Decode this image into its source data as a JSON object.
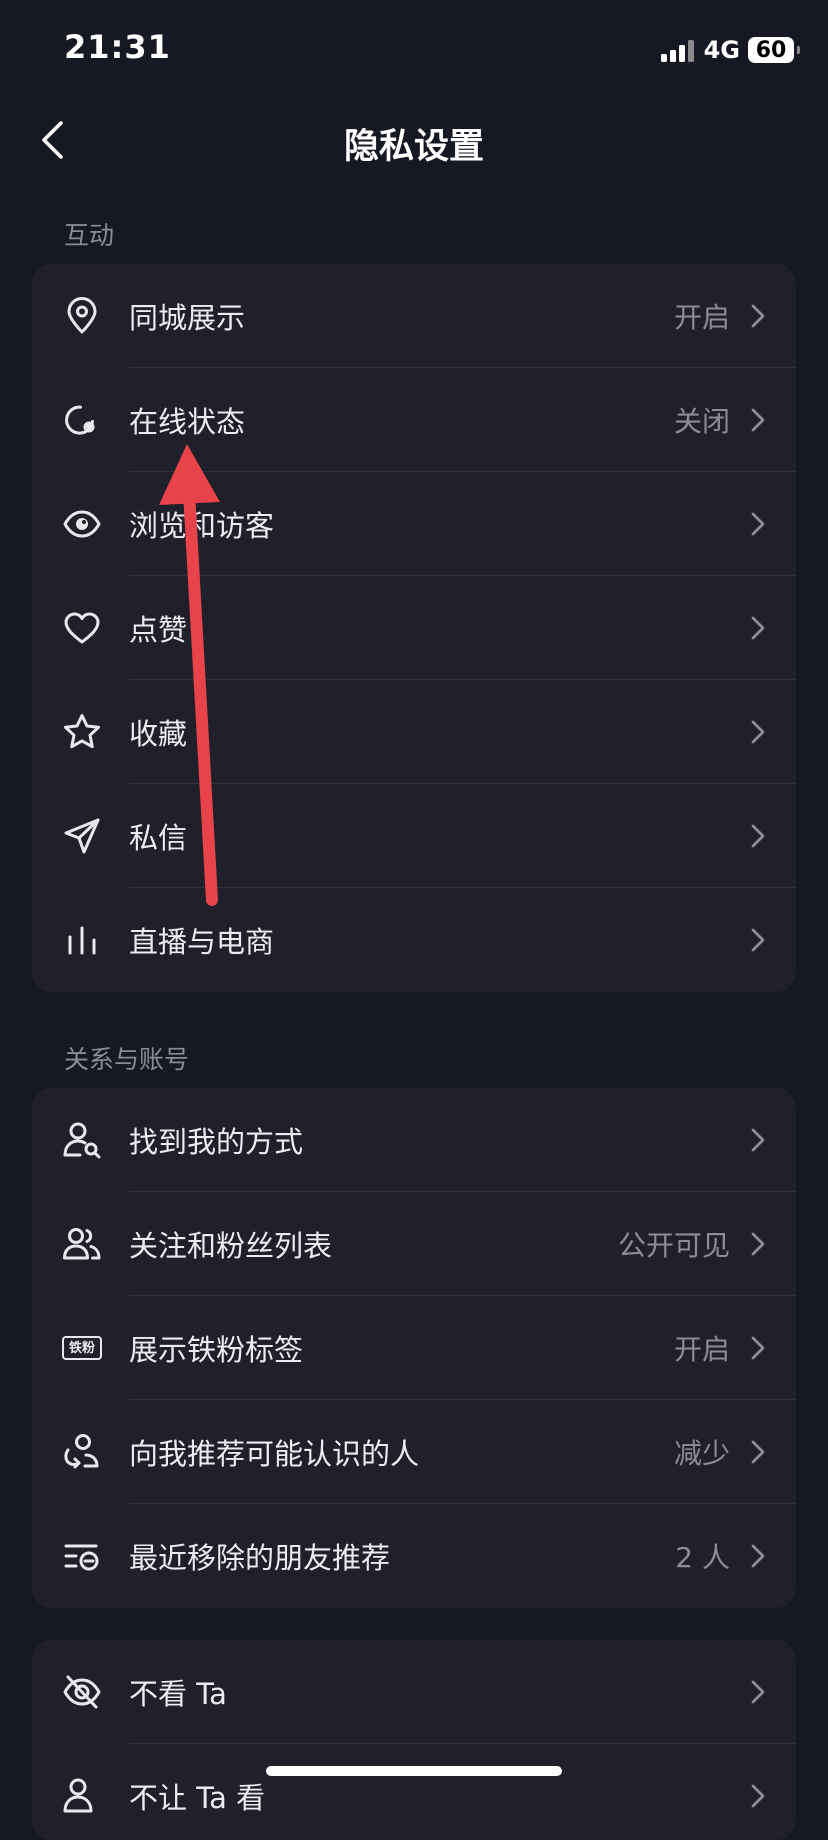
{
  "status_bar": {
    "time": "21:31",
    "network": "4G",
    "battery": "60"
  },
  "nav": {
    "title": "隐私设置"
  },
  "sections": [
    {
      "label": "互动",
      "items": [
        {
          "name": "location",
          "icon": "location-pin-icon",
          "label": "同城展示",
          "value": "开启"
        },
        {
          "name": "online-status",
          "icon": "online-status-icon",
          "label": "在线状态",
          "value": "关闭"
        },
        {
          "name": "browse-visitors",
          "icon": "eye-icon",
          "label": "浏览和访客",
          "value": ""
        },
        {
          "name": "likes",
          "icon": "heart-icon",
          "label": "点赞",
          "value": ""
        },
        {
          "name": "favorites",
          "icon": "star-icon",
          "label": "收藏",
          "value": ""
        },
        {
          "name": "messages",
          "icon": "paper-plane-icon",
          "label": "私信",
          "value": ""
        },
        {
          "name": "live-commerce",
          "icon": "bar-chart-icon",
          "label": "直播与电商",
          "value": ""
        }
      ]
    },
    {
      "label": "关系与账号",
      "items": [
        {
          "name": "find-me",
          "icon": "user-search-icon",
          "label": "找到我的方式",
          "value": ""
        },
        {
          "name": "follow-fans-list",
          "icon": "users-icon",
          "label": "关注和粉丝列表",
          "value": "公开可见"
        },
        {
          "name": "iron-fan-badge",
          "icon": "iron-fan-badge-icon",
          "label": "展示铁粉标签",
          "value": "开启",
          "badge_text": "铁粉"
        },
        {
          "name": "recommend-people",
          "icon": "user-recommend-icon",
          "label": "向我推荐可能认识的人",
          "value": "减少"
        },
        {
          "name": "removed-recommendations",
          "icon": "list-removed-icon",
          "label": "最近移除的朋友推荐",
          "value": "2 人"
        }
      ]
    },
    {
      "label": "",
      "items": [
        {
          "name": "not-see",
          "icon": "eye-off-icon",
          "label": "不看 Ta",
          "value": ""
        },
        {
          "name": "hide-from",
          "icon": "user-hide-icon",
          "label": "不让 Ta 看",
          "value": ""
        }
      ]
    }
  ],
  "colors": {
    "background": "#161823",
    "card": "#1f2029",
    "text_primary": "#ececf0",
    "text_secondary": "#8b8c94",
    "annotation_arrow": "#e8424a"
  }
}
